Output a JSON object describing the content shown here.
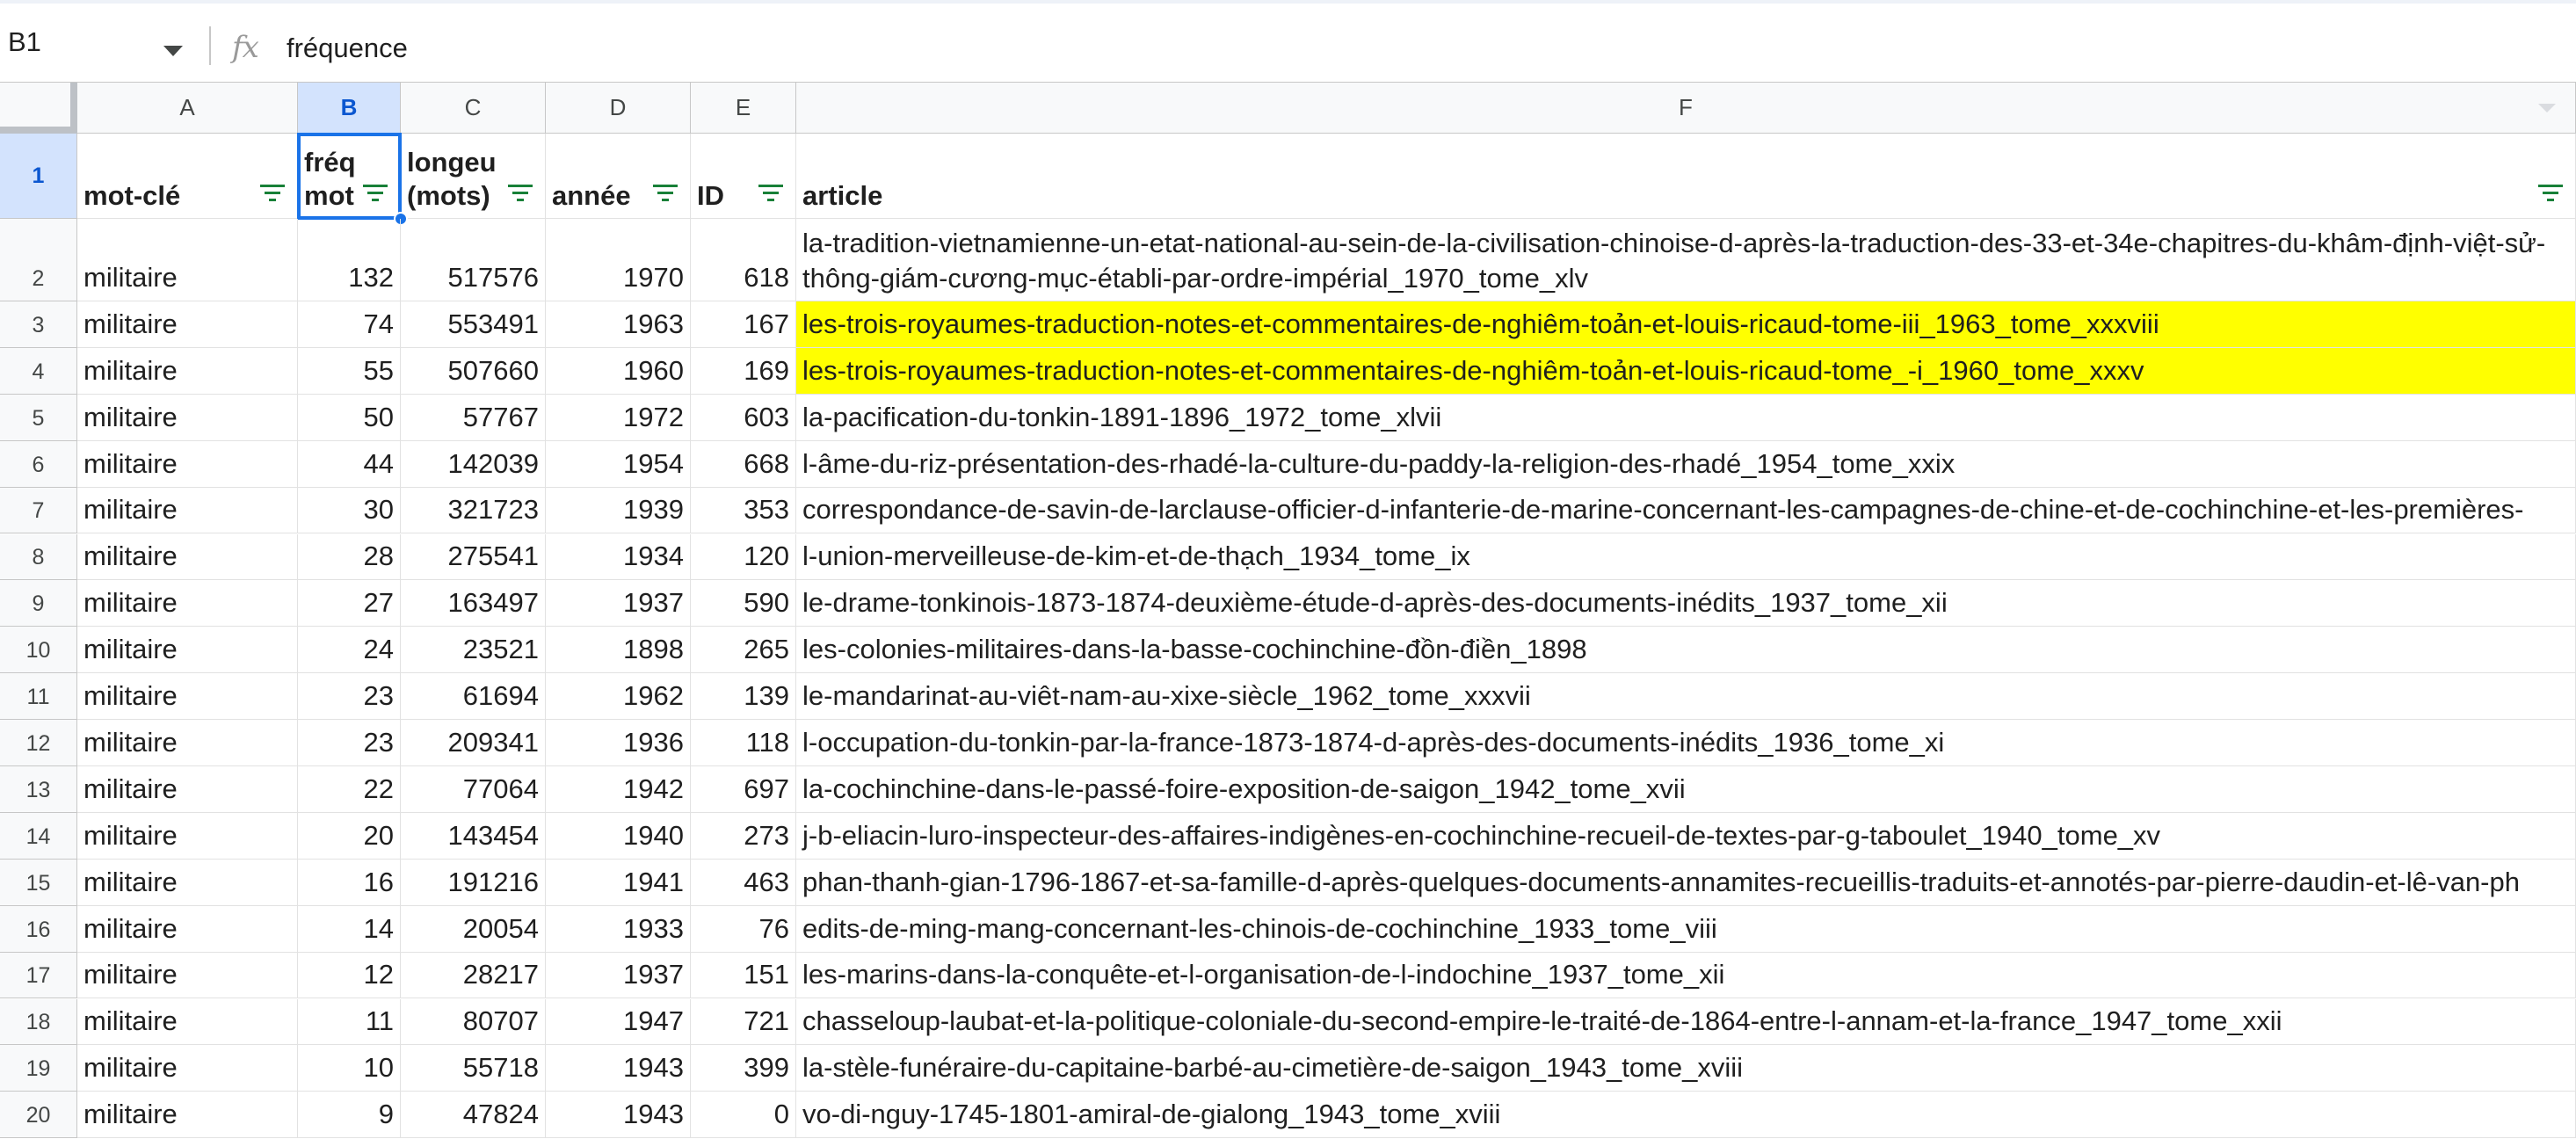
{
  "formula_bar": {
    "name_box": "B1",
    "fx_label": "fx",
    "content": "fréquence"
  },
  "columns": [
    "A",
    "B",
    "C",
    "D",
    "E",
    "F"
  ],
  "header_row": {
    "row_number": "1",
    "cells": [
      "mot-clé",
      "fréq mot",
      "longeu (mots)",
      "année",
      "ID",
      "article"
    ]
  },
  "rows": [
    {
      "n": "2",
      "keyword": "militaire",
      "freq": "132",
      "length": "517576",
      "year": "1970",
      "id": "618",
      "article": "la-tradition-vietnamienne-un-etat-national-au-sein-de-la-civilisation-chinoise-d-après-la-traduction-des-33-et-34e-chapitres-du-khâm-định-việt-sử-thông-giám-cương-mục-établi-par-ordre-impérial_1970_tome_xlv",
      "highlight": false
    },
    {
      "n": "3",
      "keyword": "militaire",
      "freq": "74",
      "length": "553491",
      "year": "1963",
      "id": "167",
      "article": "les-trois-royaumes-traduction-notes-et-commentaires-de-nghiêm-toản-et-louis-ricaud-tome-iii_1963_tome_xxxviii",
      "highlight": true
    },
    {
      "n": "4",
      "keyword": "militaire",
      "freq": "55",
      "length": "507660",
      "year": "1960",
      "id": "169",
      "article": "les-trois-royaumes-traduction-notes-et-commentaires-de-nghiêm-toản-et-louis-ricaud-tome_-i_1960_tome_xxxv",
      "highlight": true
    },
    {
      "n": "5",
      "keyword": "militaire",
      "freq": "50",
      "length": "57767",
      "year": "1972",
      "id": "603",
      "article": "la-pacification-du-tonkin-1891-1896_1972_tome_xlvii",
      "highlight": false
    },
    {
      "n": "6",
      "keyword": "militaire",
      "freq": "44",
      "length": "142039",
      "year": "1954",
      "id": "668",
      "article": "l-âme-du-riz-présentation-des-rhadé-la-culture-du-paddy-la-religion-des-rhadé_1954_tome_xxix",
      "highlight": false
    },
    {
      "n": "7",
      "keyword": "militaire",
      "freq": "30",
      "length": "321723",
      "year": "1939",
      "id": "353",
      "article": "correspondance-de-savin-de-larclause-officier-d-infanterie-de-marine-concernant-les-campagnes-de-chine-et-de-cochinchine-et-les-premières-",
      "highlight": false
    },
    {
      "n": "8",
      "keyword": "militaire",
      "freq": "28",
      "length": "275541",
      "year": "1934",
      "id": "120",
      "article": "l-union-merveilleuse-de-kim-et-de-thạch_1934_tome_ix",
      "highlight": false
    },
    {
      "n": "9",
      "keyword": "militaire",
      "freq": "27",
      "length": "163497",
      "year": "1937",
      "id": "590",
      "article": "le-drame-tonkinois-1873-1874-deuxième-étude-d-après-des-documents-inédits_1937_tome_xii",
      "highlight": false
    },
    {
      "n": "10",
      "keyword": "militaire",
      "freq": "24",
      "length": "23521",
      "year": "1898",
      "id": "265",
      "article": "les-colonies-militaires-dans-la-basse-cochinchine-đồn-điền_1898",
      "highlight": false
    },
    {
      "n": "11",
      "keyword": "militaire",
      "freq": "23",
      "length": "61694",
      "year": "1962",
      "id": "139",
      "article": "le-mandarinat-au-viêt-nam-au-xixe-siècle_1962_tome_xxxvii",
      "highlight": false
    },
    {
      "n": "12",
      "keyword": "militaire",
      "freq": "23",
      "length": "209341",
      "year": "1936",
      "id": "118",
      "article": "l-occupation-du-tonkin-par-la-france-1873-1874-d-après-des-documents-inédits_1936_tome_xi",
      "highlight": false
    },
    {
      "n": "13",
      "keyword": "militaire",
      "freq": "22",
      "length": "77064",
      "year": "1942",
      "id": "697",
      "article": "la-cochinchine-dans-le-passé-foire-exposition-de-saigon_1942_tome_xvii",
      "highlight": false
    },
    {
      "n": "14",
      "keyword": "militaire",
      "freq": "20",
      "length": "143454",
      "year": "1940",
      "id": "273",
      "article": "j-b-eliacin-luro-inspecteur-des-affaires-indigènes-en-cochinchine-recueil-de-textes-par-g-taboulet_1940_tome_xv",
      "highlight": false
    },
    {
      "n": "15",
      "keyword": "militaire",
      "freq": "16",
      "length": "191216",
      "year": "1941",
      "id": "463",
      "article": "phan-thanh-gian-1796-1867-et-sa-famille-d-après-quelques-documents-annamites-recueillis-traduits-et-annotés-par-pierre-daudin-et-lê-van-ph",
      "highlight": false
    },
    {
      "n": "16",
      "keyword": "militaire",
      "freq": "14",
      "length": "20054",
      "year": "1933",
      "id": "76",
      "article": "edits-de-ming-mang-concernant-les-chinois-de-cochinchine_1933_tome_viii",
      "highlight": false
    },
    {
      "n": "17",
      "keyword": "militaire",
      "freq": "12",
      "length": "28217",
      "year": "1937",
      "id": "151",
      "article": "les-marins-dans-la-conquête-et-l-organisation-de-l-indochine_1937_tome_xii",
      "highlight": false
    },
    {
      "n": "18",
      "keyword": "militaire",
      "freq": "11",
      "length": "80707",
      "year": "1947",
      "id": "721",
      "article": "chasseloup-laubat-et-la-politique-coloniale-du-second-empire-le-traité-de-1864-entre-l-annam-et-la-france_1947_tome_xxii",
      "highlight": false
    },
    {
      "n": "19",
      "keyword": "militaire",
      "freq": "10",
      "length": "55718",
      "year": "1943",
      "id": "399",
      "article": "la-stèle-funéraire-du-capitaine-barbé-au-cimetière-de-saigon_1943_tome_xviii",
      "highlight": false
    },
    {
      "n": "20",
      "keyword": "militaire",
      "freq": "9",
      "length": "47824",
      "year": "1943",
      "id": "0",
      "article": "vo-di-nguy-1745-1801-amiral-de-gialong_1943_tome_xviii",
      "highlight": false
    }
  ],
  "colors": {
    "highlight": "#ffff00",
    "selection": "#1a73e8",
    "filter_icon": "#188038",
    "header_bg": "#f8f9fa",
    "selected_header_bg": "#d3e3fd"
  },
  "icons": [
    "dropdown-caret-icon",
    "fx-icon",
    "filter-icon"
  ]
}
